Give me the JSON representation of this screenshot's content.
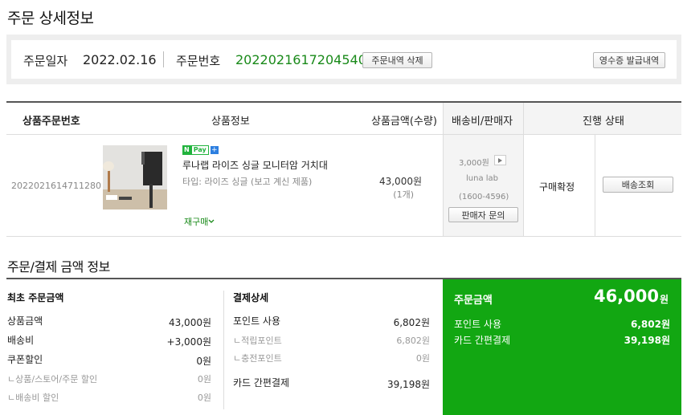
{
  "page_title": "주문 상세정보",
  "order": {
    "date_label": "주문일자",
    "date": "2022.02.16",
    "number_label": "주문번호",
    "number": "2022021617204540",
    "delete_button": "주문내역 삭제",
    "receipt_button": "영수증 발급내역"
  },
  "table": {
    "headers": [
      "상품주문번호",
      "상품정보",
      "상품금액(수량)",
      "배송비/판매자",
      "진행 상태"
    ],
    "row": {
      "product_order_no": "2022021614711280",
      "npay": {
        "n": "N",
        "pay": "Pay",
        "plus": "+"
      },
      "product_name": "루나랩 라이즈 싱글 모니터암 거치대",
      "option": "타입: 라이즈 싱글 (보고 계신 제품)",
      "rebuy": "재구매",
      "price": "43,000원",
      "qty": "(1개)",
      "shipping_fee": "3,000원",
      "seller": "luna lab",
      "seller_phone": "(1600-4596)",
      "seller_inquiry": "판매자 문의",
      "status": "구매확정",
      "tracking_button": "배송조회"
    }
  },
  "payment": {
    "section_title": "주문/결제 금액 정보",
    "initial": {
      "title": "최초 주문금액",
      "rows": [
        {
          "label": "상품금액",
          "value": "43,000원"
        },
        {
          "label": "배송비",
          "value": "+3,000원"
        },
        {
          "label": "쿠폰할인",
          "value": "0원"
        },
        {
          "label": "ㄴ상품/스토어/주문 할인",
          "value": "0원"
        },
        {
          "label": "ㄴ배송비 할인",
          "value": "0원"
        }
      ]
    },
    "detail": {
      "title": "결제상세",
      "rows": [
        {
          "label": "포인트 사용",
          "value": "6,802원"
        },
        {
          "label": "ㄴ적립포인트",
          "value": "6,802원"
        },
        {
          "label": "ㄴ충전포인트",
          "value": "0원"
        },
        {
          "label": "카드 간편결제",
          "value": "39,198원"
        }
      ]
    },
    "summary": {
      "title": "주문금액",
      "total": "46,000",
      "total_unit": "원",
      "rows": [
        {
          "label": "포인트 사용",
          "value": "6,802원"
        },
        {
          "label": "카드 간편결제",
          "value": "39,198원"
        }
      ]
    }
  },
  "colors": {
    "accent_green": "#12a712",
    "order_no_green": "#1a8a1a"
  }
}
